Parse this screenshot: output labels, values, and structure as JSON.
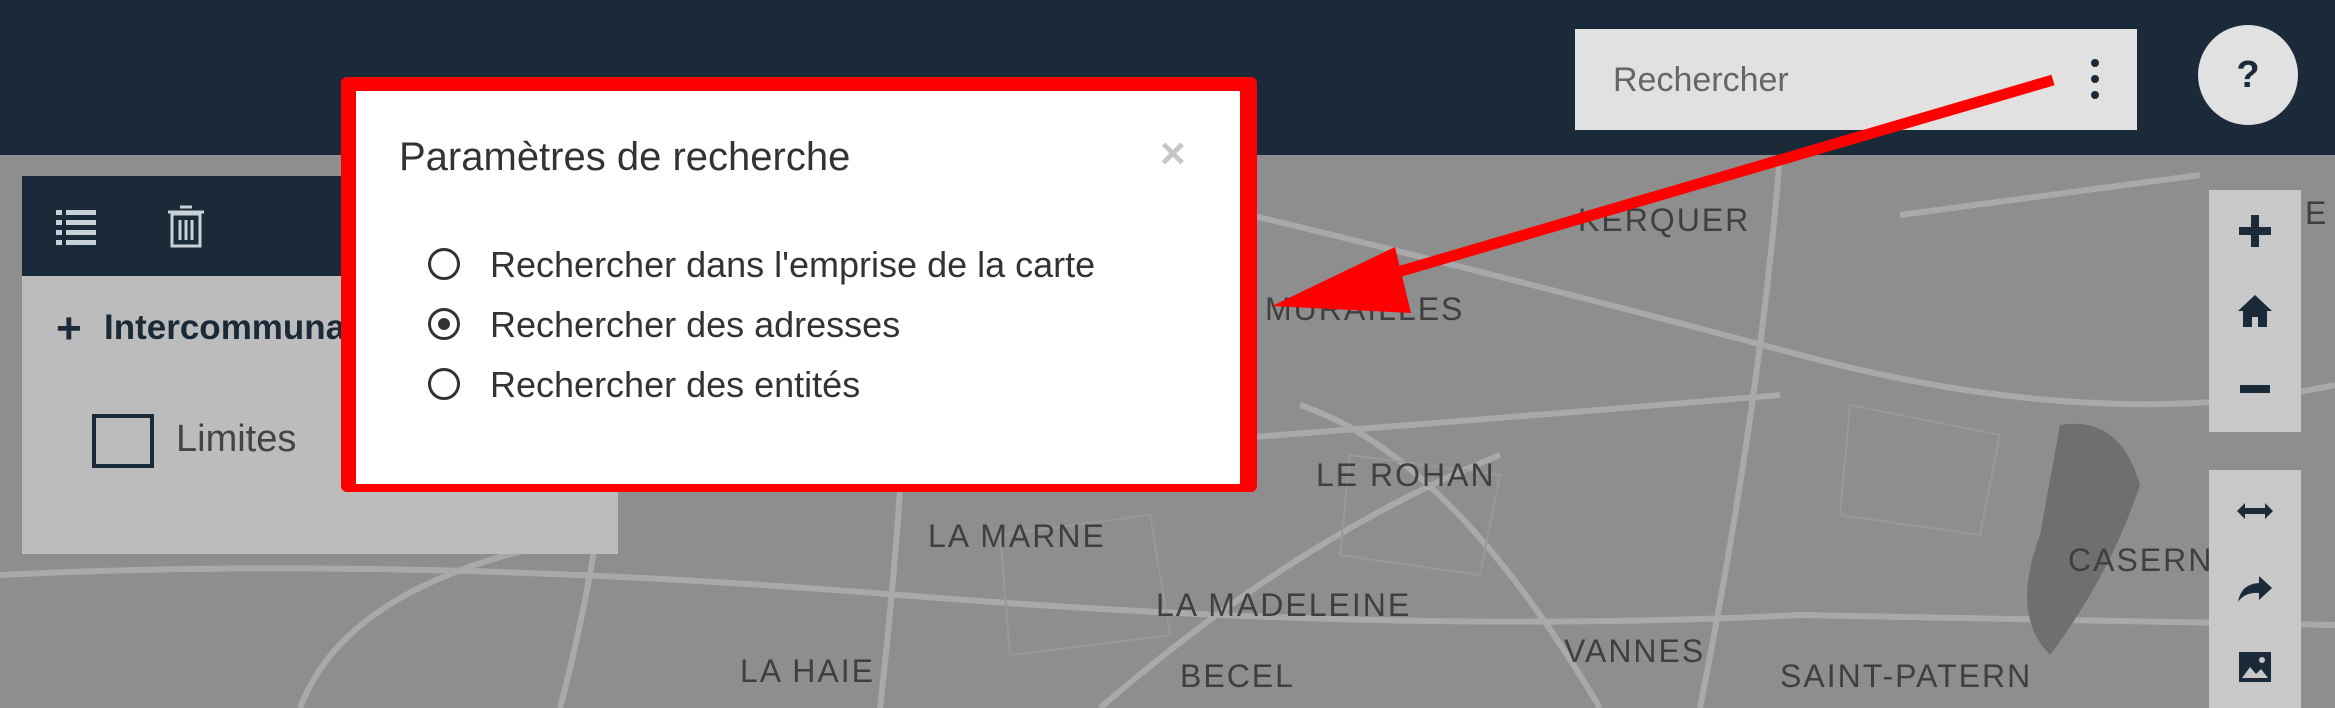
{
  "search": {
    "placeholder": "Rechercher"
  },
  "help": {
    "label": "?"
  },
  "layers": {
    "group_label": "Intercommunal",
    "layer_label": "Limites"
  },
  "map": {
    "labels": [
      "KERQUER",
      "MURAILLES",
      "LE ROHAN",
      "LA MARNE",
      "LA MADELEINE",
      "VANNES",
      "CASERN",
      "LA HAIE",
      "BECEL",
      "SAINT-PATERN",
      "E"
    ]
  },
  "search_settings": {
    "title": "Paramètres de recherche",
    "close_label": "×",
    "options": [
      {
        "label": "Rechercher dans l'emprise de la carte",
        "selected": false
      },
      {
        "label": "Rechercher des adresses",
        "selected": true
      },
      {
        "label": "Rechercher des entités",
        "selected": false
      }
    ]
  },
  "colors": {
    "topbar": "#1b2a38",
    "annotation": "#ff0000",
    "map_bg": "#8e8e8e"
  }
}
